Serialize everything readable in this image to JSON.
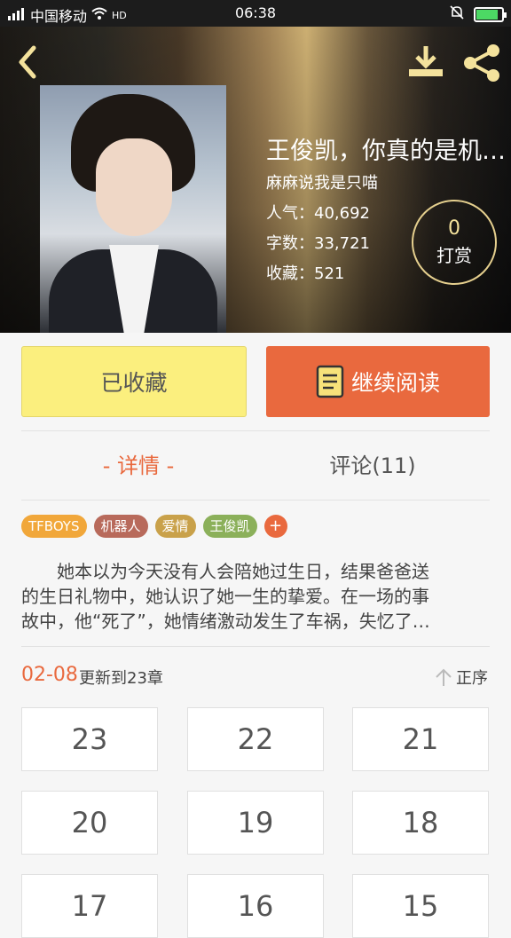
{
  "status_bar": {
    "carrier": "中国移动",
    "time": "06:38"
  },
  "book": {
    "title": "王俊凯，你真的是机…",
    "author": "麻麻说我是只喵",
    "popularity_label": "人气：",
    "popularity": "40,692",
    "words_label": "字数：",
    "words": "33,721",
    "favorites_label": "收藏：",
    "favorites": "521"
  },
  "reward": {
    "count": "0",
    "label": "打赏"
  },
  "actions": {
    "collected_label": "已收藏",
    "continue_label": "继续阅读"
  },
  "tabs": {
    "detail": "- 详情 -",
    "comments": "评论(11)"
  },
  "tags": [
    {
      "label": "TFBOYS",
      "color": "#f1a73a"
    },
    {
      "label": "机器人",
      "color": "#b86a5b"
    },
    {
      "label": "爱情",
      "color": "#c9a14a"
    },
    {
      "label": "王俊凯",
      "color": "#8bb05a"
    }
  ],
  "tag_add_label": "+",
  "summary": {
    "line1": "　　她本以为今天没有人会陪她过生日，结果爸爸送",
    "line2": "的生日礼物中，她认识了她一生的挚爱。在一场的事",
    "line3": "故中，他“死了”，她情绪激动发生了车祸，失忆了…"
  },
  "update": {
    "date": "02-08",
    "text": "更新到23章",
    "order_label": "正序"
  },
  "chapters": [
    "23",
    "22",
    "21",
    "20",
    "19",
    "18",
    "17",
    "16",
    "15"
  ],
  "colors": {
    "accent": "#e9693e",
    "collected_bg": "#fbef7e",
    "icon_yellow": "#f4e29c"
  }
}
